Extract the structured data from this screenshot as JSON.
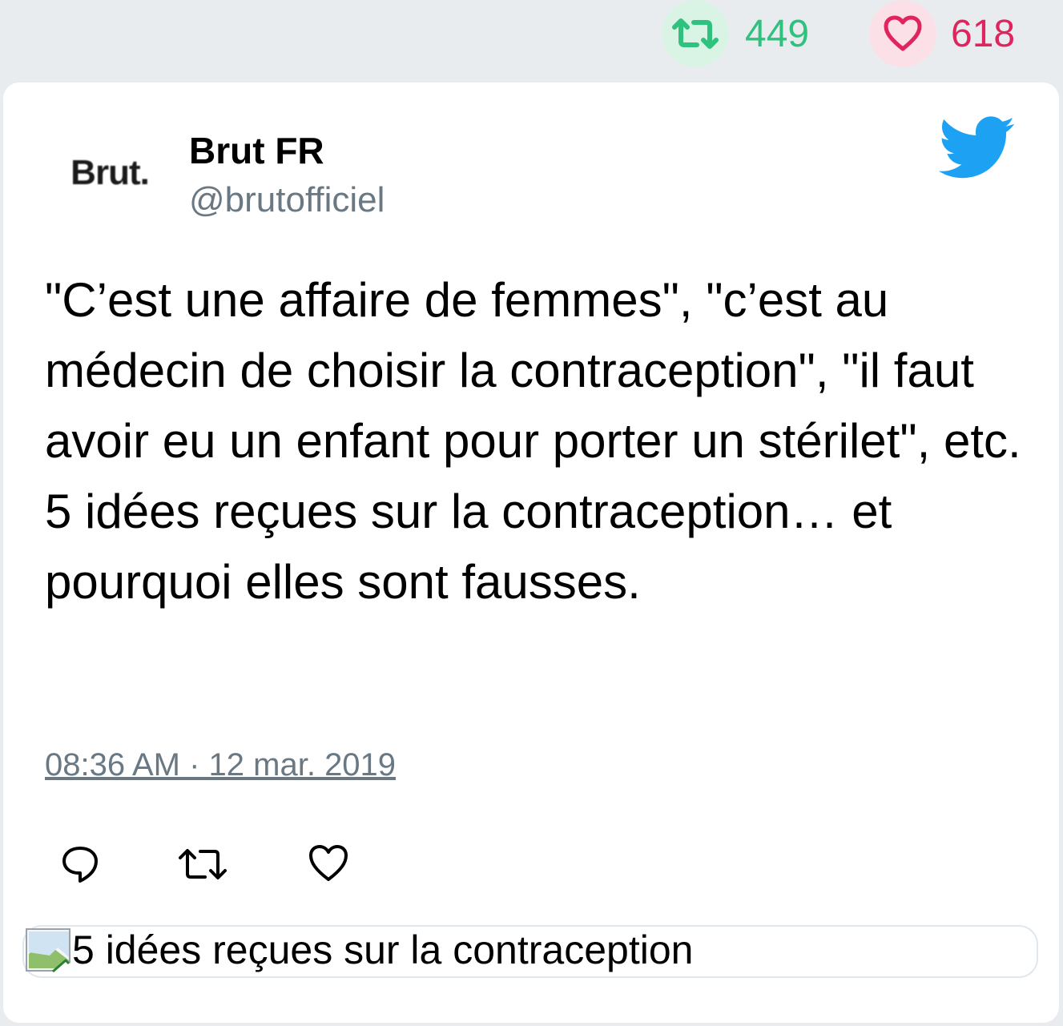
{
  "stats": {
    "retweets": "449",
    "likes": "618",
    "retweet_color": "#2ec27e",
    "like_color": "#e0245e"
  },
  "tweet": {
    "avatar_text": "Brut.",
    "author_name": "Brut FR",
    "author_handle": "@brutofficiel",
    "text": "\"C’est une affaire de femmes\", \"c’est au médecin de choisir la contraception\", \"il faut avoir eu un enfant pour porter un stérilet\", etc. 5 idées reçues sur la contraception… et pourquoi elles sont fausses.",
    "timestamp": "08:36 AM · 12 mar. 2019",
    "media_alt": "5 idées reçues sur la contraception"
  },
  "icons": {
    "top_retweet": "retweet-icon",
    "top_like": "heart-icon",
    "brand": "twitter-bird-icon",
    "reply": "reply-icon",
    "retweet": "retweet-icon",
    "like": "heart-icon",
    "broken_image": "broken-image-icon"
  },
  "brand_color": "#1da1f2"
}
